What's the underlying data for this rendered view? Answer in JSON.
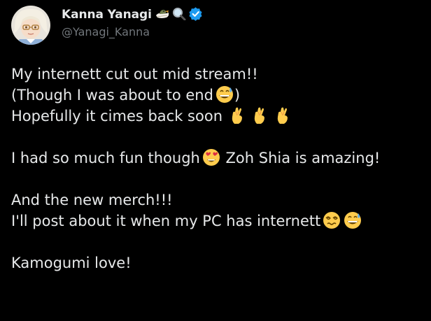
{
  "author": {
    "display_name": "Kanna Yanagi",
    "handle": "@Yanagi_Kanna",
    "name_badges": [
      "duck-emoji",
      "magnifier-emoji",
      "verified-icon"
    ],
    "verified_color": "#1d9bf0"
  },
  "tweet": {
    "lines": [
      "My internett cut out mid stream!!",
      "(Though I was about to end",
      ")",
      "Hopefully it cimes back soon",
      "I had so much fun though",
      " Zoh Shia is amazing!",
      "And the new merch!!!",
      "I'll post about it when my PC has internett",
      "Kamogumi love!"
    ]
  },
  "colors": {
    "background": "#000000",
    "text": "#e7e9ea",
    "muted": "#71767b"
  }
}
